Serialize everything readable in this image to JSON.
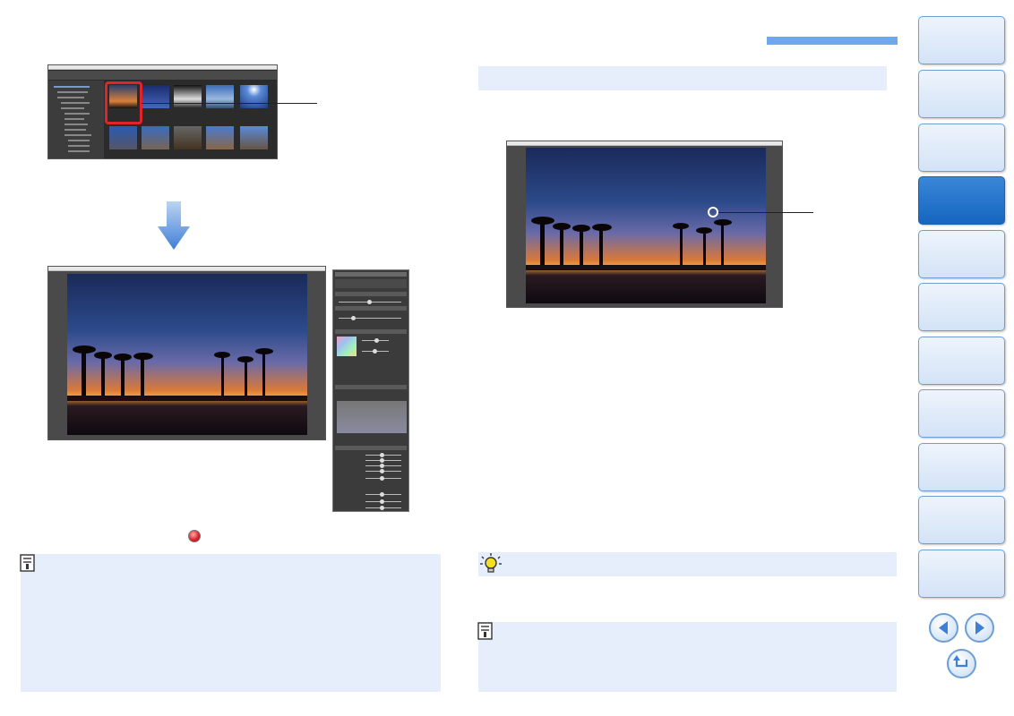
{
  "page": {
    "left_column": {
      "screenshot_browser_alt": "",
      "down_arrow_icon": "arrow-down-icon",
      "inline_icon": "red-record-icon",
      "note_icon": "memo-icon"
    },
    "right_column": {
      "tip_icon": "lightbulb-icon",
      "note_icon": "memo-icon"
    },
    "nav": {
      "tabs": [
        "",
        "",
        "",
        "",
        "",
        "",
        "",
        "",
        "",
        "",
        ""
      ],
      "active_tab_index": 3,
      "prev_icon": "arrow-left-icon",
      "next_icon": "arrow-right-icon",
      "return_icon": "return-icon"
    },
    "colors": {
      "accent_blue": "#6fa8ec",
      "note_bg": "#e6eefb",
      "nav_active": "#1566c0",
      "highlight_red": "#e0252a"
    }
  }
}
